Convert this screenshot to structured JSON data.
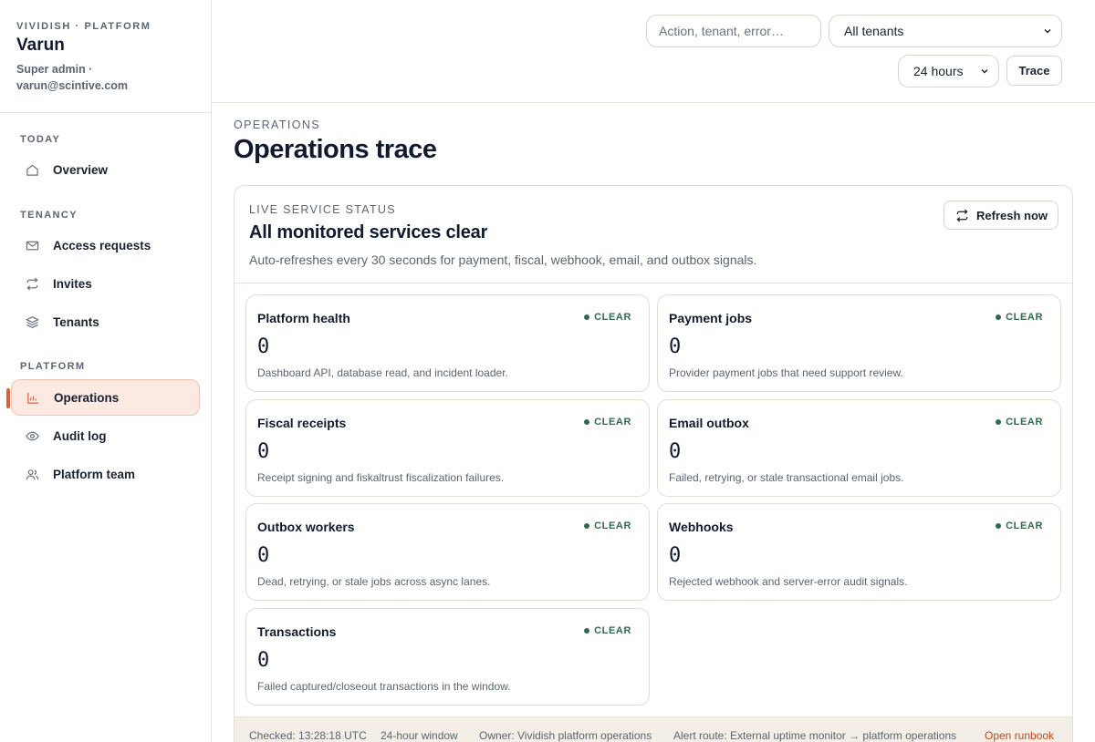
{
  "sidebar": {
    "brand_eyebrow": "VIVIDISH · PLATFORM",
    "user_name": "Varun",
    "user_role": "Super admin ·",
    "user_email": "varun@scintive.com",
    "sections": {
      "today": "TODAY",
      "tenancy": "TENANCY",
      "platform": "PLATFORM"
    },
    "items": {
      "overview": "Overview",
      "access_requests": "Access requests",
      "invites": "Invites",
      "tenants": "Tenants",
      "operations": "Operations",
      "audit_log": "Audit log",
      "platform_team": "Platform team"
    },
    "active_item": "Operations"
  },
  "topbar": {
    "search_placeholder": "Action, tenant, error…",
    "tenant_select": "All tenants",
    "window_select": "24 hours",
    "trace_label": "Trace"
  },
  "header": {
    "eyebrow": "OPERATIONS",
    "title": "Operations trace"
  },
  "status_panel": {
    "eyebrow": "LIVE SERVICE STATUS",
    "title": "All monitored services clear",
    "description": "Auto-refreshes every 30 seconds for payment, fiscal, webhook, email, and outbox signals.",
    "refresh_label": "Refresh now",
    "cards": [
      {
        "title": "Platform health",
        "status": "CLEAR",
        "value": "0",
        "description": "Dashboard API, database read, and incident loader."
      },
      {
        "title": "Payment jobs",
        "status": "CLEAR",
        "value": "0",
        "description": "Provider payment jobs that need support review."
      },
      {
        "title": "Fiscal receipts",
        "status": "CLEAR",
        "value": "0",
        "description": "Receipt signing and fiskaltrust fiscalization failures."
      },
      {
        "title": "Email outbox",
        "status": "CLEAR",
        "value": "0",
        "description": "Failed, retrying, or stale transactional email jobs."
      },
      {
        "title": "Outbox workers",
        "status": "CLEAR",
        "value": "0",
        "description": "Dead, retrying, or stale jobs across async lanes."
      },
      {
        "title": "Webhooks",
        "status": "CLEAR",
        "value": "0",
        "description": "Rejected webhook and server-error audit signals."
      },
      {
        "title": "Transactions",
        "status": "CLEAR",
        "value": "0",
        "description": "Failed captured/closeout transactions in the window."
      }
    ],
    "footer": {
      "checked": "Checked: 13:28:18 UTC",
      "window": "24-hour window",
      "owner": "Owner: Vividish platform operations",
      "alert_route": "Alert route: External uptime monitor → platform operations",
      "runbook_link": "Open runbook"
    }
  },
  "colors": {
    "accent": "#d9603b",
    "clear_status": "#2f6b4a",
    "link": "#c2461f"
  },
  "icons": {
    "overview": "home-icon",
    "access_requests": "mail-icon",
    "invites": "repeat-icon",
    "tenants": "layers-icon",
    "operations": "bar-chart-icon",
    "audit_log": "eye-icon",
    "platform_team": "users-icon",
    "refresh": "refresh-icon",
    "select": "chevron-down-icon"
  }
}
